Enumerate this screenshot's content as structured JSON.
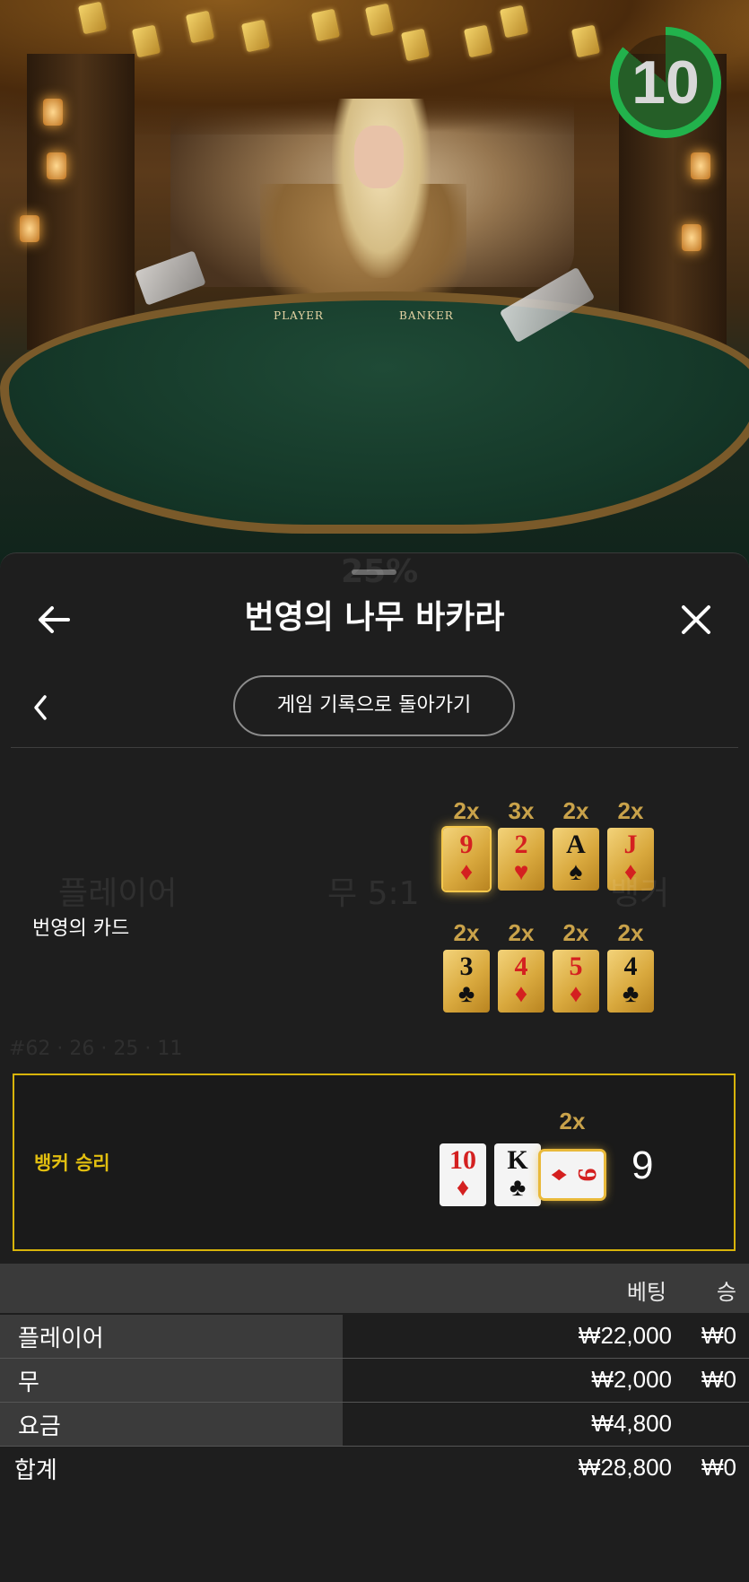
{
  "video": {
    "timer": "10",
    "timer_fraction": 0.86,
    "table_player_label": "PLAYER",
    "table_banker_label": "BANKER"
  },
  "header": {
    "title": "번영의 나무 바카라",
    "back_icon": "arrow-left-icon",
    "close_icon": "close-icon"
  },
  "nav": {
    "back_to_history": "게임 기록으로 돌아가기",
    "prev_icon": "chevron-left-icon"
  },
  "lucky_cards": {
    "label": "번영의 카드",
    "cards": [
      {
        "mult": "2x",
        "rank": "9",
        "suit": "♦",
        "color": "red",
        "highlight": true
      },
      {
        "mult": "3x",
        "rank": "2",
        "suit": "♥",
        "color": "red",
        "highlight": false
      },
      {
        "mult": "2x",
        "rank": "A",
        "suit": "♠",
        "color": "black",
        "highlight": false
      },
      {
        "mult": "2x",
        "rank": "J",
        "suit": "♦",
        "color": "red",
        "highlight": false
      },
      {
        "mult": "2x",
        "rank": "3",
        "suit": "♣",
        "color": "black",
        "highlight": false
      },
      {
        "mult": "2x",
        "rank": "4",
        "suit": "♦",
        "color": "red",
        "highlight": false
      },
      {
        "mult": "2x",
        "rank": "5",
        "suit": "♦",
        "color": "red",
        "highlight": false
      },
      {
        "mult": "2x",
        "rank": "4",
        "suit": "♣",
        "color": "black",
        "highlight": false
      }
    ]
  },
  "result": {
    "label": "뱅커 승리",
    "cards": [
      {
        "rank": "10",
        "suit": "♦",
        "color": "red"
      },
      {
        "rank": "K",
        "suit": "♣",
        "color": "black"
      },
      {
        "rank": "9",
        "suit": "♦",
        "color": "red",
        "mult": "2x",
        "rotated": true
      }
    ],
    "total": "9"
  },
  "bets": {
    "col_bet": "베팅",
    "col_win": "승",
    "rows": [
      {
        "label": "플레이어",
        "bet": "₩22,000",
        "win": "₩0"
      },
      {
        "label": "무",
        "bet": "₩2,000",
        "win": "₩0"
      },
      {
        "label": "요금",
        "bet": "₩4,800",
        "win": ""
      }
    ],
    "total": {
      "label": "합계",
      "bet": "₩28,800",
      "win": "₩0"
    }
  },
  "colors": {
    "accent_gold": "#d8b40a",
    "timer_green": "#22b24c",
    "sheet_bg": "#1e1e1e"
  }
}
